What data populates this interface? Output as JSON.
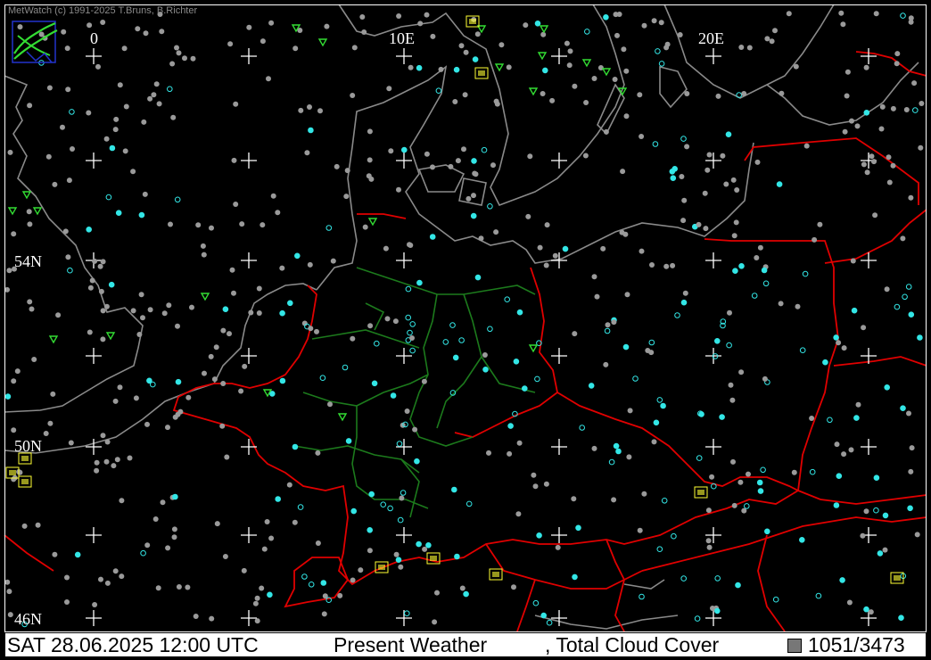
{
  "credit": "MetWatch  (c) 1991-2025 T.Bruns, B.Richter",
  "grid_labels": {
    "lon_0": "0",
    "lon_10": "10E",
    "lon_20": "20E",
    "lat_54": "54N",
    "lat_50": "50N",
    "lat_46": "46N"
  },
  "status_bar": {
    "date_time": "SAT 28.06.2025 12:00 UTC",
    "product": "Present Weather",
    "overlay": ", Total Cloud Cover",
    "station_count": "1051/3473"
  },
  "colors": {
    "background": "#000000",
    "coastline": "#8a8a8a",
    "country_border": "#e00000",
    "state_border": "#1c7a1c",
    "station_dot": "#9a9a9a",
    "cloud_cover_symbol": "#33e6e6",
    "weather_symbol_yellow": "#ffff33",
    "weather_symbol_green": "#33dd33",
    "grid_cross": "#ffffff"
  }
}
